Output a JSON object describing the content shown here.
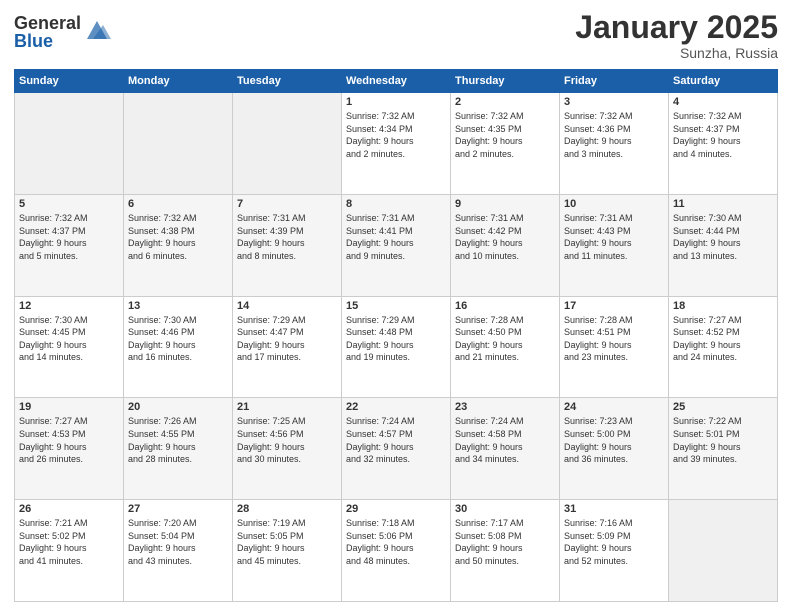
{
  "header": {
    "logo_general": "General",
    "logo_blue": "Blue",
    "month": "January 2025",
    "location": "Sunzha, Russia"
  },
  "weekdays": [
    "Sunday",
    "Monday",
    "Tuesday",
    "Wednesday",
    "Thursday",
    "Friday",
    "Saturday"
  ],
  "weeks": [
    [
      {
        "day": "",
        "info": ""
      },
      {
        "day": "",
        "info": ""
      },
      {
        "day": "",
        "info": ""
      },
      {
        "day": "1",
        "info": "Sunrise: 7:32 AM\nSunset: 4:34 PM\nDaylight: 9 hours\nand 2 minutes."
      },
      {
        "day": "2",
        "info": "Sunrise: 7:32 AM\nSunset: 4:35 PM\nDaylight: 9 hours\nand 2 minutes."
      },
      {
        "day": "3",
        "info": "Sunrise: 7:32 AM\nSunset: 4:36 PM\nDaylight: 9 hours\nand 3 minutes."
      },
      {
        "day": "4",
        "info": "Sunrise: 7:32 AM\nSunset: 4:37 PM\nDaylight: 9 hours\nand 4 minutes."
      }
    ],
    [
      {
        "day": "5",
        "info": "Sunrise: 7:32 AM\nSunset: 4:37 PM\nDaylight: 9 hours\nand 5 minutes."
      },
      {
        "day": "6",
        "info": "Sunrise: 7:32 AM\nSunset: 4:38 PM\nDaylight: 9 hours\nand 6 minutes."
      },
      {
        "day": "7",
        "info": "Sunrise: 7:31 AM\nSunset: 4:39 PM\nDaylight: 9 hours\nand 8 minutes."
      },
      {
        "day": "8",
        "info": "Sunrise: 7:31 AM\nSunset: 4:41 PM\nDaylight: 9 hours\nand 9 minutes."
      },
      {
        "day": "9",
        "info": "Sunrise: 7:31 AM\nSunset: 4:42 PM\nDaylight: 9 hours\nand 10 minutes."
      },
      {
        "day": "10",
        "info": "Sunrise: 7:31 AM\nSunset: 4:43 PM\nDaylight: 9 hours\nand 11 minutes."
      },
      {
        "day": "11",
        "info": "Sunrise: 7:30 AM\nSunset: 4:44 PM\nDaylight: 9 hours\nand 13 minutes."
      }
    ],
    [
      {
        "day": "12",
        "info": "Sunrise: 7:30 AM\nSunset: 4:45 PM\nDaylight: 9 hours\nand 14 minutes."
      },
      {
        "day": "13",
        "info": "Sunrise: 7:30 AM\nSunset: 4:46 PM\nDaylight: 9 hours\nand 16 minutes."
      },
      {
        "day": "14",
        "info": "Sunrise: 7:29 AM\nSunset: 4:47 PM\nDaylight: 9 hours\nand 17 minutes."
      },
      {
        "day": "15",
        "info": "Sunrise: 7:29 AM\nSunset: 4:48 PM\nDaylight: 9 hours\nand 19 minutes."
      },
      {
        "day": "16",
        "info": "Sunrise: 7:28 AM\nSunset: 4:50 PM\nDaylight: 9 hours\nand 21 minutes."
      },
      {
        "day": "17",
        "info": "Sunrise: 7:28 AM\nSunset: 4:51 PM\nDaylight: 9 hours\nand 23 minutes."
      },
      {
        "day": "18",
        "info": "Sunrise: 7:27 AM\nSunset: 4:52 PM\nDaylight: 9 hours\nand 24 minutes."
      }
    ],
    [
      {
        "day": "19",
        "info": "Sunrise: 7:27 AM\nSunset: 4:53 PM\nDaylight: 9 hours\nand 26 minutes."
      },
      {
        "day": "20",
        "info": "Sunrise: 7:26 AM\nSunset: 4:55 PM\nDaylight: 9 hours\nand 28 minutes."
      },
      {
        "day": "21",
        "info": "Sunrise: 7:25 AM\nSunset: 4:56 PM\nDaylight: 9 hours\nand 30 minutes."
      },
      {
        "day": "22",
        "info": "Sunrise: 7:24 AM\nSunset: 4:57 PM\nDaylight: 9 hours\nand 32 minutes."
      },
      {
        "day": "23",
        "info": "Sunrise: 7:24 AM\nSunset: 4:58 PM\nDaylight: 9 hours\nand 34 minutes."
      },
      {
        "day": "24",
        "info": "Sunrise: 7:23 AM\nSunset: 5:00 PM\nDaylight: 9 hours\nand 36 minutes."
      },
      {
        "day": "25",
        "info": "Sunrise: 7:22 AM\nSunset: 5:01 PM\nDaylight: 9 hours\nand 39 minutes."
      }
    ],
    [
      {
        "day": "26",
        "info": "Sunrise: 7:21 AM\nSunset: 5:02 PM\nDaylight: 9 hours\nand 41 minutes."
      },
      {
        "day": "27",
        "info": "Sunrise: 7:20 AM\nSunset: 5:04 PM\nDaylight: 9 hours\nand 43 minutes."
      },
      {
        "day": "28",
        "info": "Sunrise: 7:19 AM\nSunset: 5:05 PM\nDaylight: 9 hours\nand 45 minutes."
      },
      {
        "day": "29",
        "info": "Sunrise: 7:18 AM\nSunset: 5:06 PM\nDaylight: 9 hours\nand 48 minutes."
      },
      {
        "day": "30",
        "info": "Sunrise: 7:17 AM\nSunset: 5:08 PM\nDaylight: 9 hours\nand 50 minutes."
      },
      {
        "day": "31",
        "info": "Sunrise: 7:16 AM\nSunset: 5:09 PM\nDaylight: 9 hours\nand 52 minutes."
      },
      {
        "day": "",
        "info": ""
      }
    ]
  ]
}
